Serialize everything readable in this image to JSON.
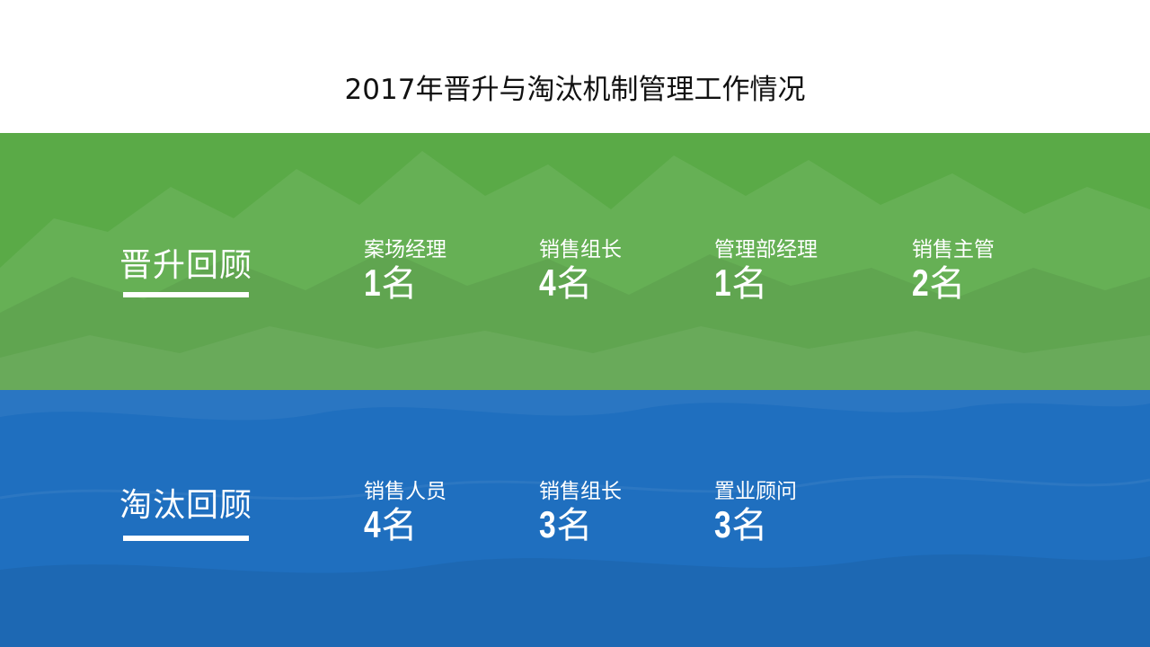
{
  "title": "2017年晋升与淘汰机制管理工作情况",
  "colors": {
    "promotion_band": "#5aaa47",
    "elimination_band": "#1f6fbf",
    "text": "#ffffff"
  },
  "promotion": {
    "heading": "晋升回顾",
    "items": [
      {
        "label": "案场经理",
        "number": "1",
        "unit": "名"
      },
      {
        "label": "销售组长",
        "number": "4",
        "unit": "名"
      },
      {
        "label": "管理部经理",
        "number": "1",
        "unit": "名"
      },
      {
        "label": "销售主管",
        "number": "2",
        "unit": "名"
      }
    ]
  },
  "elimination": {
    "heading": "淘汰回顾",
    "items": [
      {
        "label": "销售人员",
        "number": "4",
        "unit": "名"
      },
      {
        "label": "销售组长",
        "number": "3",
        "unit": "名"
      },
      {
        "label": "置业顾问",
        "number": "3",
        "unit": "名"
      }
    ]
  }
}
